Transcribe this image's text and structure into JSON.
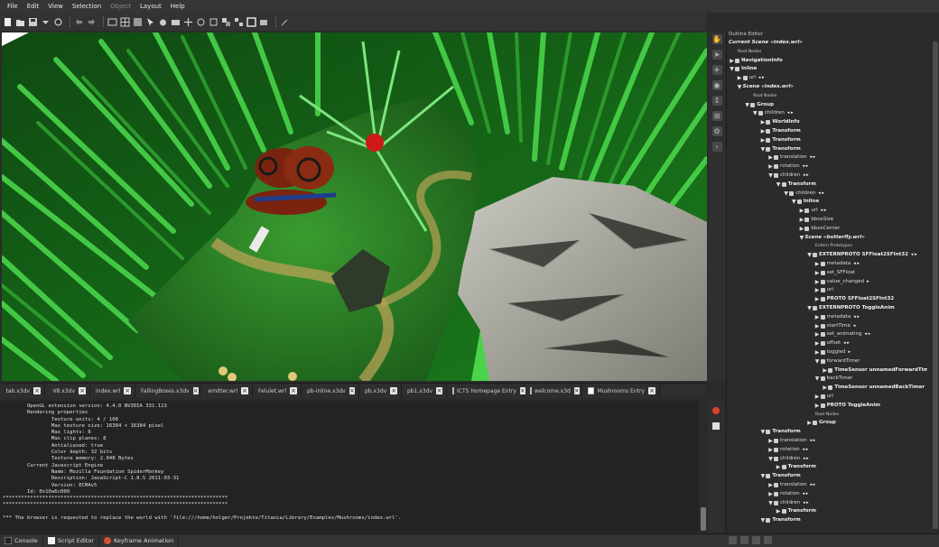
{
  "menubar": {
    "items": [
      {
        "label": "File",
        "enabled": true
      },
      {
        "label": "Edit",
        "enabled": true
      },
      {
        "label": "View",
        "enabled": true
      },
      {
        "label": "Selection",
        "enabled": true
      },
      {
        "label": "Object",
        "enabled": false
      },
      {
        "label": "Layout",
        "enabled": true
      },
      {
        "label": "Help",
        "enabled": true
      }
    ]
  },
  "file_tabs": [
    {
      "label": "tab.x3dv",
      "icon": false
    },
    {
      "label": "V8.x3dv",
      "icon": false
    },
    {
      "label": "index.wrl",
      "icon": false
    },
    {
      "label": "FallingBoxes.x3dv",
      "icon": false
    },
    {
      "label": "emitter.wrl",
      "icon": false
    },
    {
      "label": "Felulet.wrl",
      "icon": false
    },
    {
      "label": "pb-inline.x3dv",
      "icon": false
    },
    {
      "label": "pb.x3dv",
      "icon": false
    },
    {
      "label": "pb1.x3dv",
      "icon": false
    },
    {
      "label": "ICTS Homepage Entry",
      "icon": true
    },
    {
      "label": "welcome.x3d",
      "icon": true
    },
    {
      "label": "Mushrooms Entry",
      "icon": true
    }
  ],
  "console": {
    "lines": [
      "        OpenGL extension version: 4.4.0 NVIDIA 331.113",
      "        Rendering properties",
      "                Texture units: 4 / 108",
      "                Max texture size: 16384 × 16384 pixel",
      "                Max lights: 8",
      "                Max clip planes: 8",
      "                Antialiased: true",
      "                Color depth: 32 bits",
      "                Texture memory: 2.048 Bytes",
      "        Current Javascript Engine",
      "                Name: Mozilla Foundation SpiderMonkey",
      "                Description: JavaScript-C 1.8.5 2011-03-31",
      "                Version: ECMAv5",
      "        Id: 0x10a6c000",
      "**************************************************************************",
      "**************************************************************************",
      "",
      "*** The browser is requested to replace the world with 'file:///home/holger/Projekte/Titania/Library/Examples/Mushrooms/index.wrl'.",
      "",
      ""
    ]
  },
  "bottom_tabs": [
    {
      "label": "Console",
      "icon": "console-icon"
    },
    {
      "label": "Script Editor",
      "icon": "script-editor-icon"
    },
    {
      "label": "Keyframe Animation",
      "icon": "keyframe-animation-icon"
    }
  ],
  "outline": {
    "title": "Outline Editor",
    "nodes": [
      {
        "label": "Current Scene «index.wrl»",
        "style": "bi",
        "indent": 0,
        "arrow": "",
        "icon": false
      },
      {
        "label": "Root Nodes",
        "style": "small",
        "indent": 0,
        "arrow": "",
        "icon": false
      },
      {
        "label": "NavigationInfo",
        "style": "b",
        "indent": 0,
        "arrow": "▶",
        "icon": true
      },
      {
        "label": "Inline",
        "style": "b",
        "indent": 0,
        "arrow": "▼",
        "icon": true
      },
      {
        "label": "url",
        "style": "",
        "indent": 1,
        "arrow": "▶",
        "icon": true,
        "extra": "◂ ▸"
      },
      {
        "label": "Scene «index.wrl»",
        "style": "bi",
        "indent": 1,
        "arrow": "▼",
        "icon": false
      },
      {
        "label": "Root Nodes",
        "style": "small",
        "indent": 2,
        "arrow": "",
        "icon": false
      },
      {
        "label": "Group",
        "style": "b",
        "indent": 2,
        "arrow": "▼",
        "icon": true
      },
      {
        "label": "children",
        "style": "",
        "indent": 3,
        "arrow": "▼",
        "icon": true,
        "extra": "◂ ▸"
      },
      {
        "label": "WorldInfo",
        "style": "b",
        "indent": 4,
        "arrow": "▶",
        "icon": true
      },
      {
        "label": "Transform",
        "style": "b",
        "indent": 4,
        "arrow": "▶",
        "icon": true
      },
      {
        "label": "Transform",
        "style": "b",
        "indent": 4,
        "arrow": "▶",
        "icon": true
      },
      {
        "label": "Transform",
        "style": "b",
        "indent": 4,
        "arrow": "▼",
        "icon": true
      },
      {
        "label": "translation",
        "style": "",
        "indent": 5,
        "arrow": "▶",
        "icon": true,
        "extra": "◂ ▸"
      },
      {
        "label": "rotation",
        "style": "",
        "indent": 5,
        "arrow": "▶",
        "icon": true,
        "extra": "◂ ▸"
      },
      {
        "label": "children",
        "style": "",
        "indent": 5,
        "arrow": "▼",
        "icon": true,
        "extra": "◂ ▸"
      },
      {
        "label": "Transform",
        "style": "b",
        "indent": 6,
        "arrow": "▼",
        "icon": true
      },
      {
        "label": "children",
        "style": "",
        "indent": 7,
        "arrow": "▼",
        "icon": true,
        "extra": "◂ ▸"
      },
      {
        "label": "Inline",
        "style": "b",
        "indent": 8,
        "arrow": "▼",
        "icon": true
      },
      {
        "label": "url",
        "style": "",
        "indent": 9,
        "arrow": "▶",
        "icon": true,
        "extra": "◂ ▸"
      },
      {
        "label": "bboxSize",
        "style": "",
        "indent": 9,
        "arrow": "▶",
        "icon": true
      },
      {
        "label": "bboxCenter",
        "style": "",
        "indent": 9,
        "arrow": "▶",
        "icon": true
      },
      {
        "label": "Scene «butterfly.wrl»",
        "style": "bi",
        "indent": 9,
        "arrow": "▼",
        "icon": false
      },
      {
        "label": "Extern Prototypes",
        "style": "small",
        "indent": 10,
        "arrow": "",
        "icon": false
      },
      {
        "label": "EXTERNPROTO SFFloat2SFInt32",
        "style": "b",
        "indent": 10,
        "arrow": "▼",
        "icon": true,
        "extra": "◂ ▸"
      },
      {
        "label": "metadata",
        "style": "",
        "indent": 11,
        "arrow": "▶",
        "icon": true,
        "extra": "◂ ▸"
      },
      {
        "label": "set_SFFloat",
        "style": "",
        "indent": 11,
        "arrow": "▶",
        "icon": true
      },
      {
        "label": "value_changed",
        "style": "",
        "indent": 11,
        "arrow": "▶",
        "icon": true,
        "extra": "▸"
      },
      {
        "label": "url",
        "style": "",
        "indent": 11,
        "arrow": "▶",
        "icon": true
      },
      {
        "label": "PROTO SFFloat2SFInt32",
        "style": "b",
        "indent": 11,
        "arrow": "▶",
        "icon": true
      },
      {
        "label": "EXTERNPROTO ToggleAnim",
        "style": "b",
        "indent": 10,
        "arrow": "▼",
        "icon": true
      },
      {
        "label": "metadata",
        "style": "",
        "indent": 11,
        "arrow": "▶",
        "icon": true,
        "extra": "◂ ▸"
      },
      {
        "label": "startTime",
        "style": "",
        "indent": 11,
        "arrow": "▶",
        "icon": true,
        "extra": "◂"
      },
      {
        "label": "set_animating",
        "style": "",
        "indent": 11,
        "arrow": "▶",
        "icon": true,
        "extra": "◂ ▸"
      },
      {
        "label": "offset",
        "style": "",
        "indent": 11,
        "arrow": "▶",
        "icon": true,
        "extra": "◂ ▸"
      },
      {
        "label": "toggled",
        "style": "",
        "indent": 11,
        "arrow": "▶",
        "icon": true,
        "extra": "▸"
      },
      {
        "label": "forwardTimer",
        "style": "",
        "indent": 11,
        "arrow": "▼",
        "icon": true
      },
      {
        "label": "TimeSensor unnamedForwardTimer",
        "style": "b",
        "indent": 12,
        "arrow": "▶",
        "icon": true
      },
      {
        "label": "backTimer",
        "style": "",
        "indent": 11,
        "arrow": "▼",
        "icon": true
      },
      {
        "label": "TimeSensor unnamedBackTimer",
        "style": "b",
        "indent": 12,
        "arrow": "▶",
        "icon": true
      },
      {
        "label": "url",
        "style": "",
        "indent": 11,
        "arrow": "▶",
        "icon": true
      },
      {
        "label": "PROTO ToggleAnim",
        "style": "b",
        "indent": 11,
        "arrow": "▶",
        "icon": true
      },
      {
        "label": "Root Nodes",
        "style": "small",
        "indent": 10,
        "arrow": "",
        "icon": false
      },
      {
        "label": "Group",
        "style": "b",
        "indent": 10,
        "arrow": "▶",
        "icon": true
      },
      {
        "label": "Transform",
        "style": "b",
        "indent": 4,
        "arrow": "▼",
        "icon": true
      },
      {
        "label": "translation",
        "style": "",
        "indent": 5,
        "arrow": "▶",
        "icon": true,
        "extra": "◂ ▸"
      },
      {
        "label": "rotation",
        "style": "",
        "indent": 5,
        "arrow": "▶",
        "icon": true,
        "extra": "◂ ▸"
      },
      {
        "label": "children",
        "style": "",
        "indent": 5,
        "arrow": "▼",
        "icon": true,
        "extra": "◂ ▸"
      },
      {
        "label": "Transform",
        "style": "b",
        "indent": 6,
        "arrow": "▶",
        "icon": true
      },
      {
        "label": "Transform",
        "style": "b",
        "indent": 4,
        "arrow": "▼",
        "icon": true
      },
      {
        "label": "translation",
        "style": "",
        "indent": 5,
        "arrow": "▶",
        "icon": true,
        "extra": "◂ ▸"
      },
      {
        "label": "rotation",
        "style": "",
        "indent": 5,
        "arrow": "▶",
        "icon": true,
        "extra": "◂ ▸"
      },
      {
        "label": "children",
        "style": "",
        "indent": 5,
        "arrow": "▼",
        "icon": true,
        "extra": "◂ ▸"
      },
      {
        "label": "Transform",
        "style": "b",
        "indent": 6,
        "arrow": "▶",
        "icon": true
      },
      {
        "label": "Transform",
        "style": "b",
        "indent": 4,
        "arrow": "▼",
        "icon": true
      }
    ]
  },
  "colors": {
    "grass_dark": "#1f6e1f",
    "grass_light": "#4bc24b",
    "path": "#b9a257",
    "rock": "#a8a8a0",
    "butterfly": "#7a2410",
    "mushroom": "#d01818"
  }
}
